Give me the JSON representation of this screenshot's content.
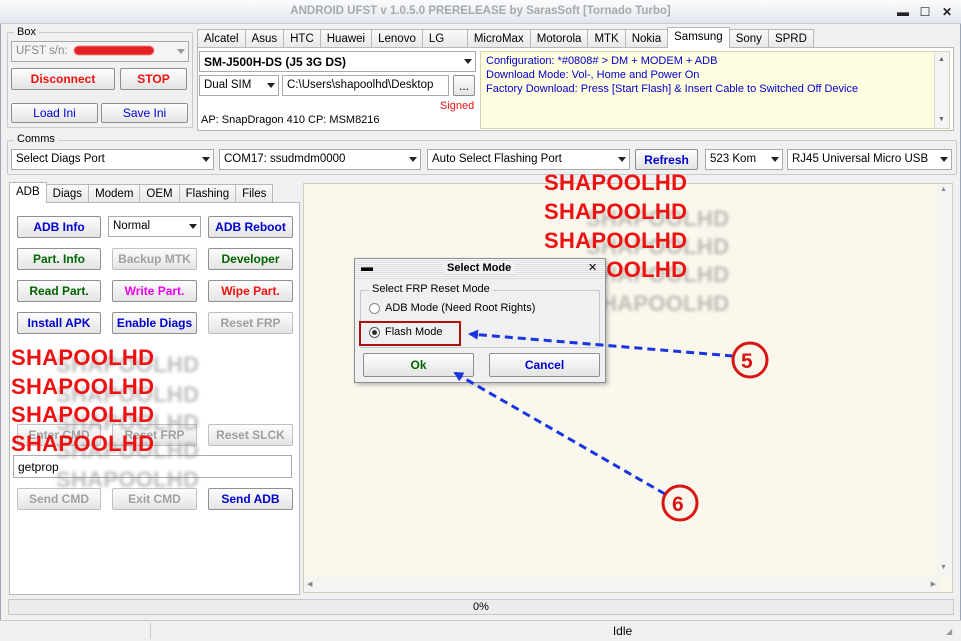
{
  "window": {
    "title": "ANDROID UFST v 1.0.5.0 PRERELEASE by SarasSoft  [Tornado Turbo]"
  },
  "box": {
    "label": "Box",
    "sn_value": "UFST s/n:",
    "disconnect_label": "Disconnect",
    "stop_label": "STOP",
    "load_ini_label": "Load Ini",
    "save_ini_label": "Save Ini"
  },
  "brand_tabs": [
    "Alcatel",
    "Asus",
    "HTC",
    "Huawei",
    "Lenovo",
    "LG",
    "MicroMax",
    "Motorola",
    "MTK",
    "Nokia",
    "Samsung",
    "Sony",
    "SPRD"
  ],
  "device": {
    "model": "SM-J500H-DS (J5 3G DS)",
    "sim": "Dual SIM",
    "path": "C:\\Users\\shapoolhd\\Desktop",
    "browse_label": "...",
    "signed": "Signed",
    "ap_cp": "AP: SnapDragon 410  CP: MSM8216",
    "info_lines": [
      "Configuration: *#0808# > DM + MODEM + ADB",
      "Download Mode: Vol-, Home and Power On",
      "Factory Download: Press [Start Flash] & Insert Cable to Switched Off Device"
    ]
  },
  "comms": {
    "label": "Comms",
    "diag_port": "Select Diags Port",
    "com_port": "COM17: ssudmdm0000",
    "flash_port": "Auto Select Flashing Port",
    "refresh_label": "Refresh",
    "speed": "523 Kom",
    "cable": "RJ45 Universal Micro USB"
  },
  "func_tabs": [
    "ADB",
    "Diags",
    "Modem",
    "OEM",
    "Flashing",
    "Files"
  ],
  "adb": {
    "adb_info": "ADB Info",
    "mode": "Normal",
    "adb_reboot": "ADB Reboot",
    "part_info": "Part. Info",
    "backup_mtk": "Backup MTK",
    "developer": "Developer",
    "read_part": "Read Part.",
    "write_part": "Write Part.",
    "wipe_part": "Wipe Part.",
    "install_apk": "Install APK",
    "enable_diags": "Enable Diags",
    "reset_frp": "Reset FRP",
    "enter_cmd": "Enter CMD",
    "reset_frp2": "Reset FRP",
    "reset_slck": "Reset SLCK",
    "cmd_value": "getprop",
    "send_cmd": "Send CMD",
    "exit_cmd": "Exit CMD",
    "send_adb": "Send ADB"
  },
  "dialog": {
    "title": "Select Mode",
    "group": "Select FRP Reset Mode",
    "option1": "ADB Mode (Need Root Rights)",
    "option2": "Flash Mode",
    "selected": "Flash Mode",
    "ok_label": "Ok",
    "cancel_label": "Cancel"
  },
  "watermark": "SHAPOOLHD",
  "callouts": {
    "five": "5",
    "six": "6"
  },
  "progress": {
    "text": "0%",
    "value": 0
  },
  "status": {
    "text": "Idle"
  },
  "colors": {
    "red_text": "#ee1111",
    "blue_text": "#0000cc",
    "green_text": "#006400",
    "magenta_text": "#ee00ee",
    "arrow": "#1a35e0",
    "info_bg": "#fffde0",
    "log_bg": "#faf8ec"
  }
}
